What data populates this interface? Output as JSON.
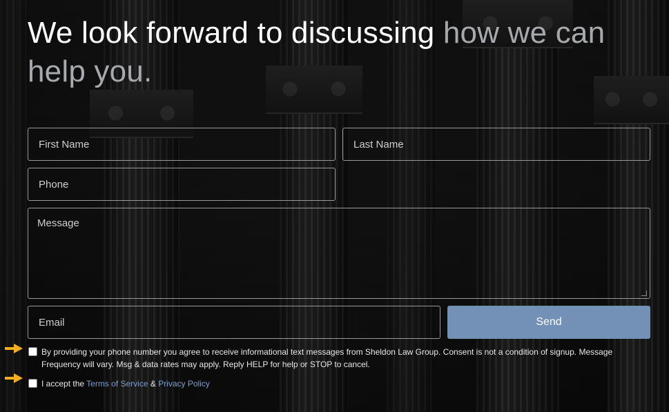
{
  "headline": {
    "part1": "We look forward to discussing ",
    "part2": "how we can help you."
  },
  "form": {
    "first_name_placeholder": "First Name",
    "last_name_placeholder": "Last Name",
    "phone_placeholder": "Phone",
    "message_placeholder": "Message",
    "email_placeholder": "Email",
    "send_label": "Send"
  },
  "consent": {
    "sms_text": "By providing your phone number you agree to receive informational text messages from Sheldon Law Group. Consent is not a condition of signup. Message Frequency will vary. Msg & data rates may apply. Reply HELP for help or STOP to cancel.",
    "terms_prefix": "I accept the ",
    "terms_link": "Terms of Service",
    "terms_join": " & ",
    "privacy_link": "Privacy Policy"
  },
  "colors": {
    "accent_button": "#7390b6",
    "link": "#7f9fcf",
    "arrow": "#f2b01e",
    "muted_heading": "#a7a9ac"
  },
  "icons": {
    "arrow": "pointing-right-arrow-icon",
    "resize_grip": "textarea-resize-icon"
  }
}
